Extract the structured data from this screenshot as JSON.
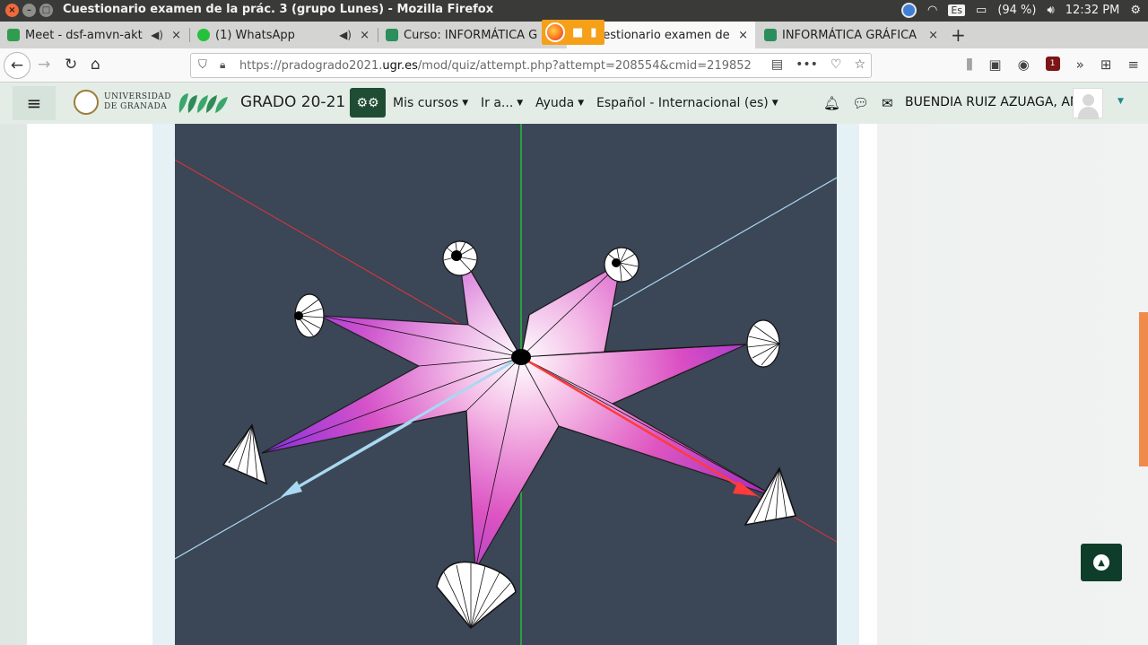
{
  "os_bar": {
    "window_title": "Cuestionario examen de la prác. 3 (grupo Lunes) - Mozilla Firefox",
    "keyboard": "Es",
    "battery": "(94 %)",
    "time": "12:32 PM"
  },
  "tabs": [
    {
      "label": "Meet - dsf-amvn-akt",
      "icon": "google-meet-icon",
      "audio": true
    },
    {
      "label": "(1) WhatsApp",
      "icon": "whatsapp-icon",
      "audio": true
    },
    {
      "label": "Curso: INFORMÁTICA G",
      "icon": "prado-icon",
      "audio": false
    },
    {
      "label": "uestionario examen de",
      "icon": "prado-icon",
      "audio": false,
      "active": true
    },
    {
      "label": "INFORMÁTICA GRÁFICA",
      "icon": "prado-icon",
      "audio": false
    }
  ],
  "address_bar": {
    "url_prefix": "https://pradogrado2021.",
    "url_domain": "ugr.es",
    "url_path": "/mod/quiz/attempt.php?attempt=208554&cmid=219852",
    "addon_badge": "1"
  },
  "site_header": {
    "university_line1": "UNIVERSIDAD",
    "university_line2": "DE GRANADA",
    "site_name": "GRADO 20-21",
    "menu": [
      "Mis cursos",
      "Ir a...",
      "Ayuda",
      "Español - Internacional (es)"
    ],
    "user_name": "BUENDIA RUIZ AZUAGA, ANA"
  },
  "colors": {
    "canvas_bg": "#3b4656",
    "header_bg": "#e3ede6",
    "accent": "#1e4d34",
    "axis_x": "#ff3b3b",
    "axis_y": "#22dd33",
    "axis_z": "#a9d8f2"
  }
}
